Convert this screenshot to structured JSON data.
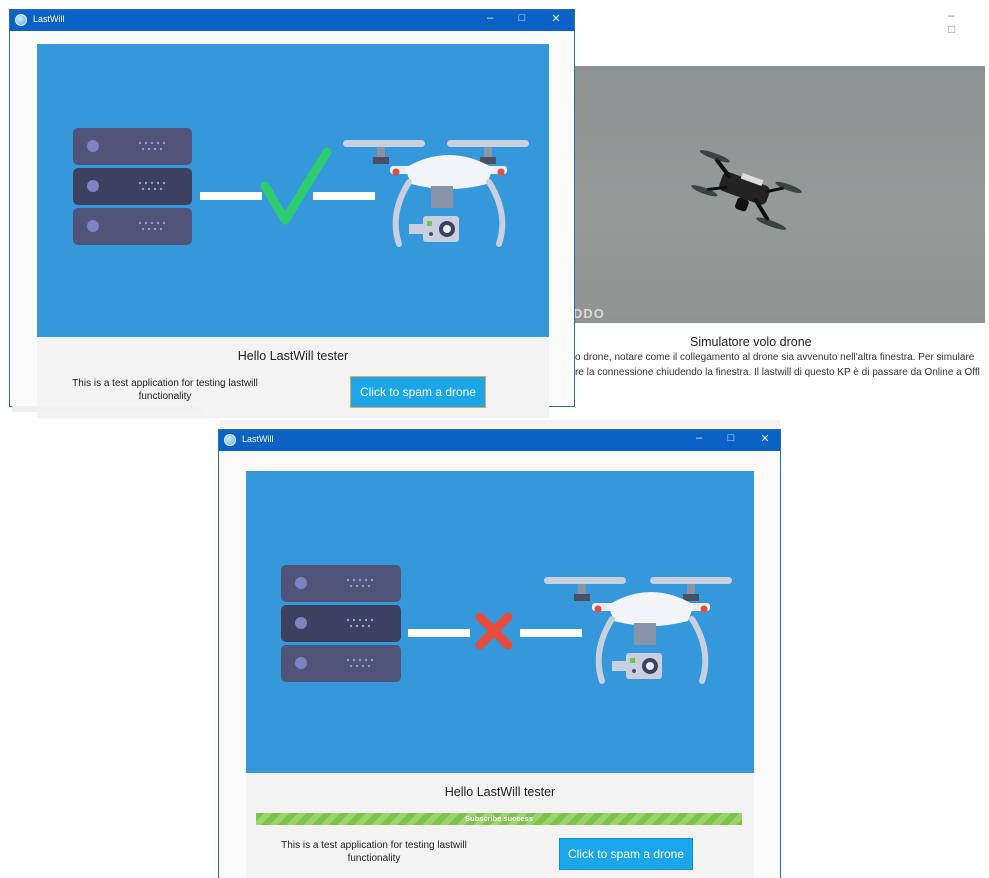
{
  "background_window": {
    "controls": [
      "–",
      "□"
    ],
    "watermark": "DDO",
    "title": "Simulatore volo drone",
    "text_line1": "o drone, notare come il collegamento al drone sia avvenuto nell'altra finestra. Per simulare",
    "text_line2": "re la connessione chiudendo la finestra. Il lastwill di questo KP è di passare da Online a Offl"
  },
  "window_connected": {
    "title": "LastWill",
    "controls": [
      "–",
      "□",
      "✕"
    ],
    "status_icon": "check-icon",
    "hello": "Hello LastWill tester",
    "description": "This is a test application for testing lastwill functionality",
    "button": "Click to spam a drone"
  },
  "window_disconnected": {
    "title": "LastWill",
    "controls": [
      "–",
      "□",
      "✕"
    ],
    "status_icon": "cross-icon",
    "hello": "Hello LastWill tester",
    "progress_label": "Subscribe success",
    "progress": 1.0,
    "description": "This is a test application for testing lastwill functionality",
    "button": "Click to spam a drone"
  },
  "colors": {
    "hero": "#3498db",
    "titlebar": "#0a63c4",
    "check": "#2ecc71",
    "cross": "#e74c3c",
    "progress": "#8cc152",
    "button": "#1aa6e8"
  }
}
